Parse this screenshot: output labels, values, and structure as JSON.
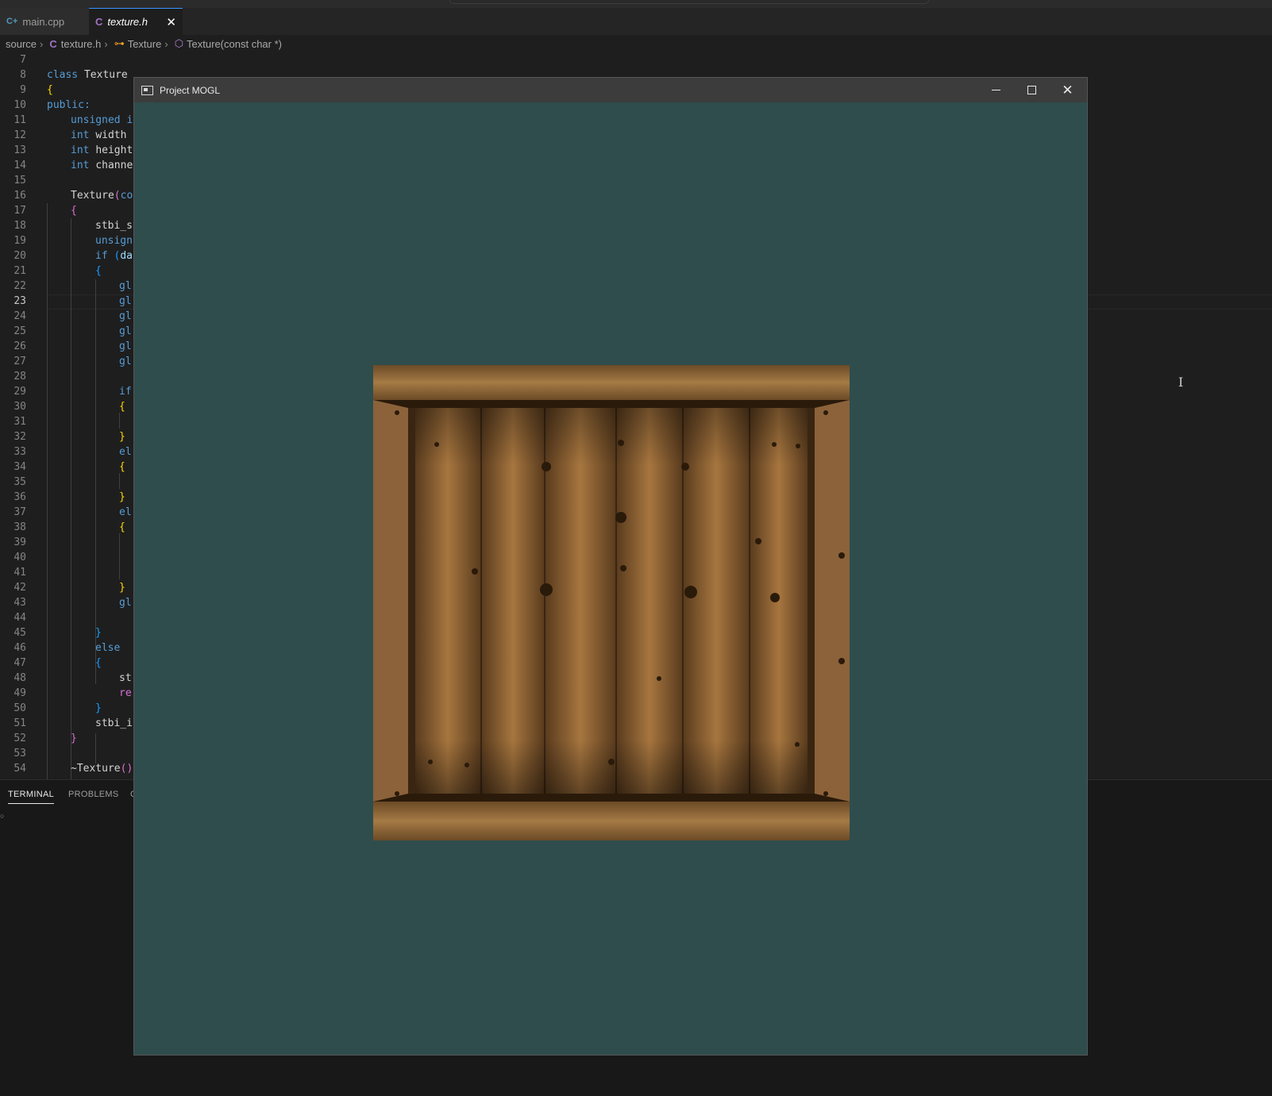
{
  "tabs": [
    {
      "icon": "C+",
      "label": "main.cpp"
    },
    {
      "icon": "C",
      "label": "texture.h",
      "close": "✕"
    }
  ],
  "breadcrumb": {
    "folder": "source",
    "file": "texture.h",
    "class": "Texture",
    "method": "Texture(const char *)"
  },
  "editor": {
    "current_line": 23,
    "lines": [
      {
        "n": "7"
      },
      {
        "n": "8"
      },
      {
        "n": "9"
      },
      {
        "n": "10"
      },
      {
        "n": "11"
      },
      {
        "n": "12"
      },
      {
        "n": "13"
      },
      {
        "n": "14"
      },
      {
        "n": "15"
      },
      {
        "n": "16"
      },
      {
        "n": "17"
      },
      {
        "n": "18"
      },
      {
        "n": "19"
      },
      {
        "n": "20"
      },
      {
        "n": "21"
      },
      {
        "n": "22"
      },
      {
        "n": "23"
      },
      {
        "n": "24"
      },
      {
        "n": "25"
      },
      {
        "n": "26"
      },
      {
        "n": "27"
      },
      {
        "n": "28"
      },
      {
        "n": "29"
      },
      {
        "n": "30"
      },
      {
        "n": "31"
      },
      {
        "n": "32"
      },
      {
        "n": "33"
      },
      {
        "n": "34"
      },
      {
        "n": "35"
      },
      {
        "n": "36"
      },
      {
        "n": "37"
      },
      {
        "n": "38"
      },
      {
        "n": "39"
      },
      {
        "n": "40"
      },
      {
        "n": "41"
      },
      {
        "n": "42"
      },
      {
        "n": "43"
      },
      {
        "n": "44"
      },
      {
        "n": "45"
      },
      {
        "n": "46"
      },
      {
        "n": "47"
      },
      {
        "n": "48"
      },
      {
        "n": "49"
      },
      {
        "n": "50"
      },
      {
        "n": "51"
      },
      {
        "n": "52"
      },
      {
        "n": "53"
      },
      {
        "n": "54"
      }
    ],
    "code": {
      "l8_kw": "class",
      "l8_name": "Texture",
      "l9": "{",
      "l10": "public:",
      "l11_kw": "unsigned",
      "l11_rest": "i",
      "l12_kw": "int",
      "l12_rest": "width",
      "l13_kw": "int",
      "l13_rest": "height",
      "l14_kw": "int",
      "l14_rest": "channe",
      "l16_fn": "Texture",
      "l16_p": "(",
      "l16_rest": "co",
      "l17": "{",
      "l18": "stbi_s",
      "l19": "unsign",
      "l20_kw": "if",
      "l20_p": "(",
      "l20_rest": "da",
      "l21": "{",
      "l22": "gl",
      "l23": "gl",
      "l24": "gl",
      "l25": "gl",
      "l26": "gl",
      "l27": "gl",
      "l29": "if",
      "l30": "{",
      "l32": "}",
      "l33": "el",
      "l34": "{",
      "l36": "}",
      "l37": "el",
      "l38": "{",
      "l42": "}",
      "l43": "gl",
      "l45": "}",
      "l46": "else",
      "l47": "{",
      "l48": "st",
      "l49": "re",
      "l50": "}",
      "l51": "stbi_i",
      "l52": "}",
      "l54_fn": "~Texture",
      "l54_p": "()"
    }
  },
  "panel": {
    "tabs": [
      "TERMINAL",
      "PROBLEMS",
      "O"
    ]
  },
  "app_window": {
    "title": "Project MOGL",
    "background": "#2f4d4d"
  },
  "colors": {
    "keyword": "#569cd6",
    "bracket1": "#ffd700",
    "bracket2": "#da70d6",
    "bracket3": "#179fff",
    "function": "#dcdcaa"
  }
}
